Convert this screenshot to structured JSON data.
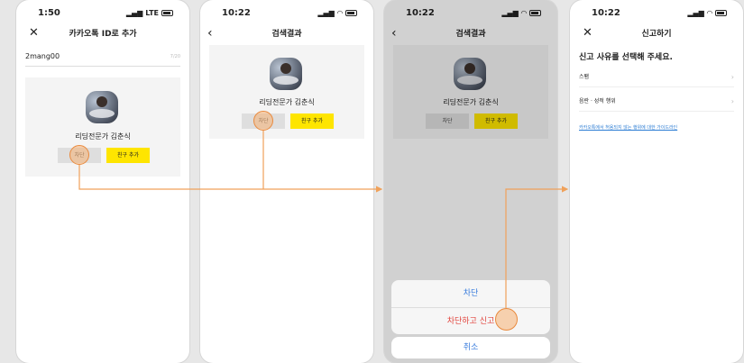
{
  "colors": {
    "accent": "#fee500",
    "tap": "#f6b172",
    "arrow": "#f0a15a",
    "link": "#2b7cd3",
    "destructive": "#e2463f"
  },
  "screen1": {
    "time": "1:50",
    "network": "LTE",
    "close_icon": "close-icon",
    "title": "카카오톡 ID로 추가",
    "id_value": "2mang00",
    "char_count": "7/20",
    "profile_name": "리딩전문가 김춘식",
    "block_label": "차단",
    "add_label": "친구 추가"
  },
  "screen2": {
    "time": "10:22",
    "back_icon": "back-icon",
    "title": "검색결과",
    "profile_name": "리딩전문가 김춘식",
    "block_label": "차단",
    "add_label": "친구 추가"
  },
  "screen3": {
    "time": "10:22",
    "title": "검색결과",
    "profile_name": "리딩전문가 김춘식",
    "block_label": "차단",
    "add_label": "친구 추가",
    "sheet": {
      "block": "차단",
      "block_report": "차단하고 신고",
      "cancel": "취소"
    }
  },
  "screen4": {
    "time": "10:22",
    "title": "신고하기",
    "heading": "신고 사유를 선택해 주세요.",
    "reasons": [
      "스팸",
      "음란 · 성적 행위"
    ],
    "guide_link": "카카오톡에서 허용되지 않는 행위에 대한 가이드라인"
  }
}
